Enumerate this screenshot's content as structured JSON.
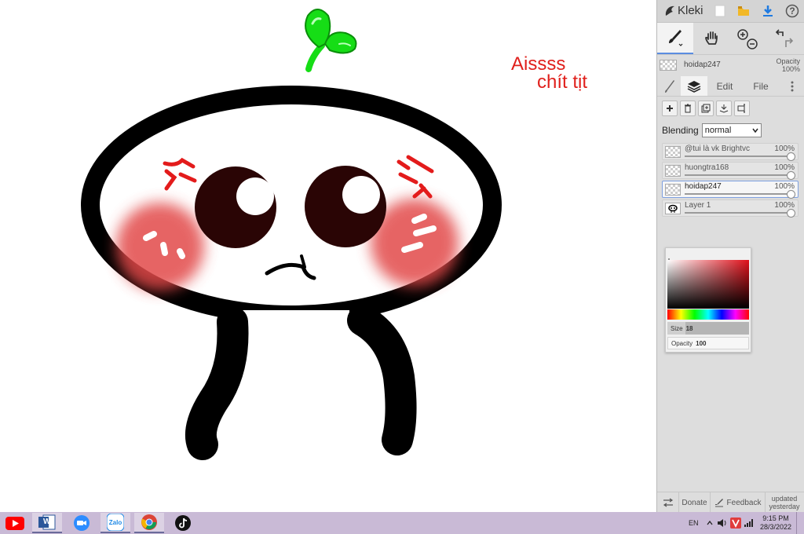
{
  "canvas": {
    "caption_line1": "Aissss",
    "caption_line2": "chít tịt",
    "caption_color": "#e0201c"
  },
  "panel": {
    "app_name": "Kleki",
    "topbar_icons": [
      "new-image-icon",
      "open-folder-icon",
      "download-icon",
      "help-icon"
    ],
    "help_symbol": "?",
    "tools": [
      "brush-tool-icon",
      "hand-tool-icon",
      "zoom-icon",
      "undo-redo-icon"
    ],
    "current_layer": {
      "name": "hoidap247",
      "opacity_label": "Opacity",
      "opacity_value": "100%"
    },
    "tabs": {
      "edit": "Edit",
      "file": "File"
    },
    "layer_buttons": [
      "add-layer-icon",
      "delete-layer-icon",
      "duplicate-layer-icon",
      "merge-layer-icon",
      "rename-layer-icon"
    ],
    "blending_label": "Blending",
    "blending_value": "normal",
    "layers": [
      {
        "name": "@tui là vk Brightvc",
        "opacity": "100%",
        "selected": false
      },
      {
        "name": "huongtra168",
        "opacity": "100%",
        "selected": false
      },
      {
        "name": "hoidap247",
        "opacity": "100%",
        "selected": true
      },
      {
        "name": "Layer 1",
        "opacity": "100%",
        "selected": false
      }
    ],
    "color_picker": {
      "size_label": "Size",
      "size_value": "18",
      "opacity_label": "Opacity",
      "opacity_value": "100",
      "selected_color": "#e0101a"
    },
    "bottom": {
      "donate": "Donate",
      "feedback": "Feedback",
      "updated_line1": "updated",
      "updated_line2": "yesterday"
    }
  },
  "taskbar": {
    "apps": [
      "youtube-icon",
      "word-icon",
      "zoom-icon",
      "zalo-icon",
      "chrome-icon",
      "tiktok-icon"
    ],
    "zalo_text": "Zalo",
    "word_letter": "W",
    "language": "EN",
    "time": "9:15 PM",
    "date": "28/3/2022",
    "background": "#c9bad6"
  }
}
